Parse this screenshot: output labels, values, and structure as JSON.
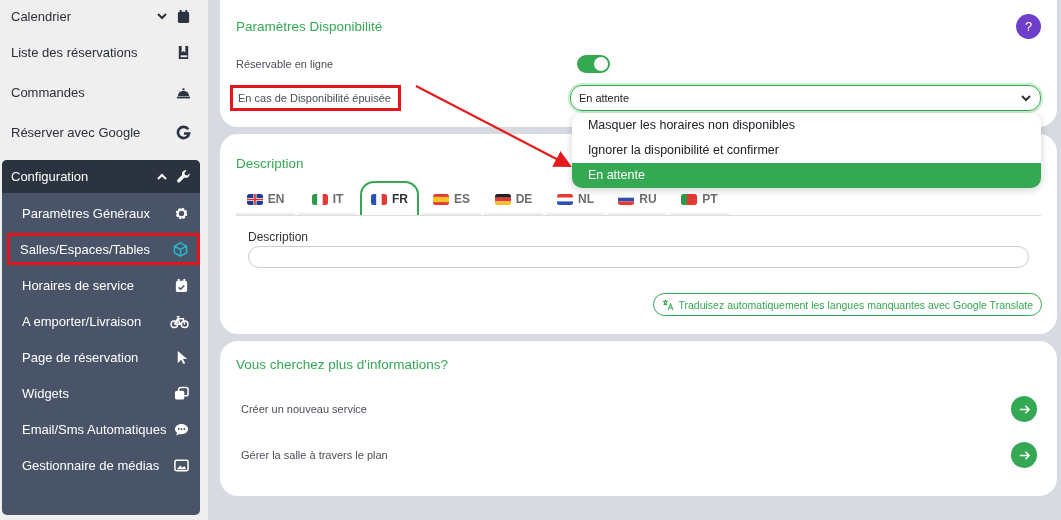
{
  "sidebar": {
    "items": [
      {
        "label": "Calendrier",
        "expanded": false
      },
      {
        "label": "Liste des réservations"
      },
      {
        "label": "Commandes"
      },
      {
        "label": "Réserver avec Google"
      }
    ],
    "group": {
      "label": "Configuration",
      "expanded": true,
      "children": [
        {
          "label": "Paramètres Généraux",
          "highlighted": false
        },
        {
          "label": "Salles/Espaces/Tables",
          "highlighted": true
        },
        {
          "label": "Horaires de service",
          "highlighted": false
        },
        {
          "label": "A emporter/Livraison",
          "highlighted": false
        },
        {
          "label": "Page de réservation",
          "highlighted": false
        },
        {
          "label": "Widgets",
          "highlighted": false
        },
        {
          "label": "Email/Sms Automatiques",
          "highlighted": false
        },
        {
          "label": "Gestionnaire de médias",
          "highlighted": false
        }
      ]
    }
  },
  "availability": {
    "title": "Paramètres Disponibilité",
    "help": "?",
    "rows": [
      {
        "kind": "toggle",
        "label": "Réservable en ligne",
        "on": true,
        "highlighted": false
      },
      {
        "kind": "select",
        "label": "En cas de Disponibilité épuisée",
        "value": "En attente",
        "highlighted": true,
        "expanded": true,
        "options": [
          {
            "label": "Masquer les horaires non disponibles",
            "selected": false
          },
          {
            "label": "Ignorer la disponibilité et confirmer",
            "selected": false
          },
          {
            "label": "En attente",
            "selected": true
          }
        ]
      }
    ]
  },
  "description": {
    "title": "Description",
    "tabs": [
      {
        "label": "EN",
        "selected": false
      },
      {
        "label": "IT",
        "selected": false
      },
      {
        "label": "FR",
        "selected": true
      },
      {
        "label": "ES",
        "selected": false
      },
      {
        "label": "DE",
        "selected": false
      },
      {
        "label": "NL",
        "selected": false
      },
      {
        "label": "RU",
        "selected": false
      },
      {
        "label": "PT",
        "selected": false
      }
    ],
    "field_label": "Description",
    "translate_button": "Traduisez automatiquement les langues manquantes avec Google Translate"
  },
  "info": {
    "title": "Vous cherchez plus d'informations?",
    "links": [
      {
        "label": "Créer un nouveau service"
      },
      {
        "label": "Gérer la salle à travers le plan"
      }
    ]
  }
}
